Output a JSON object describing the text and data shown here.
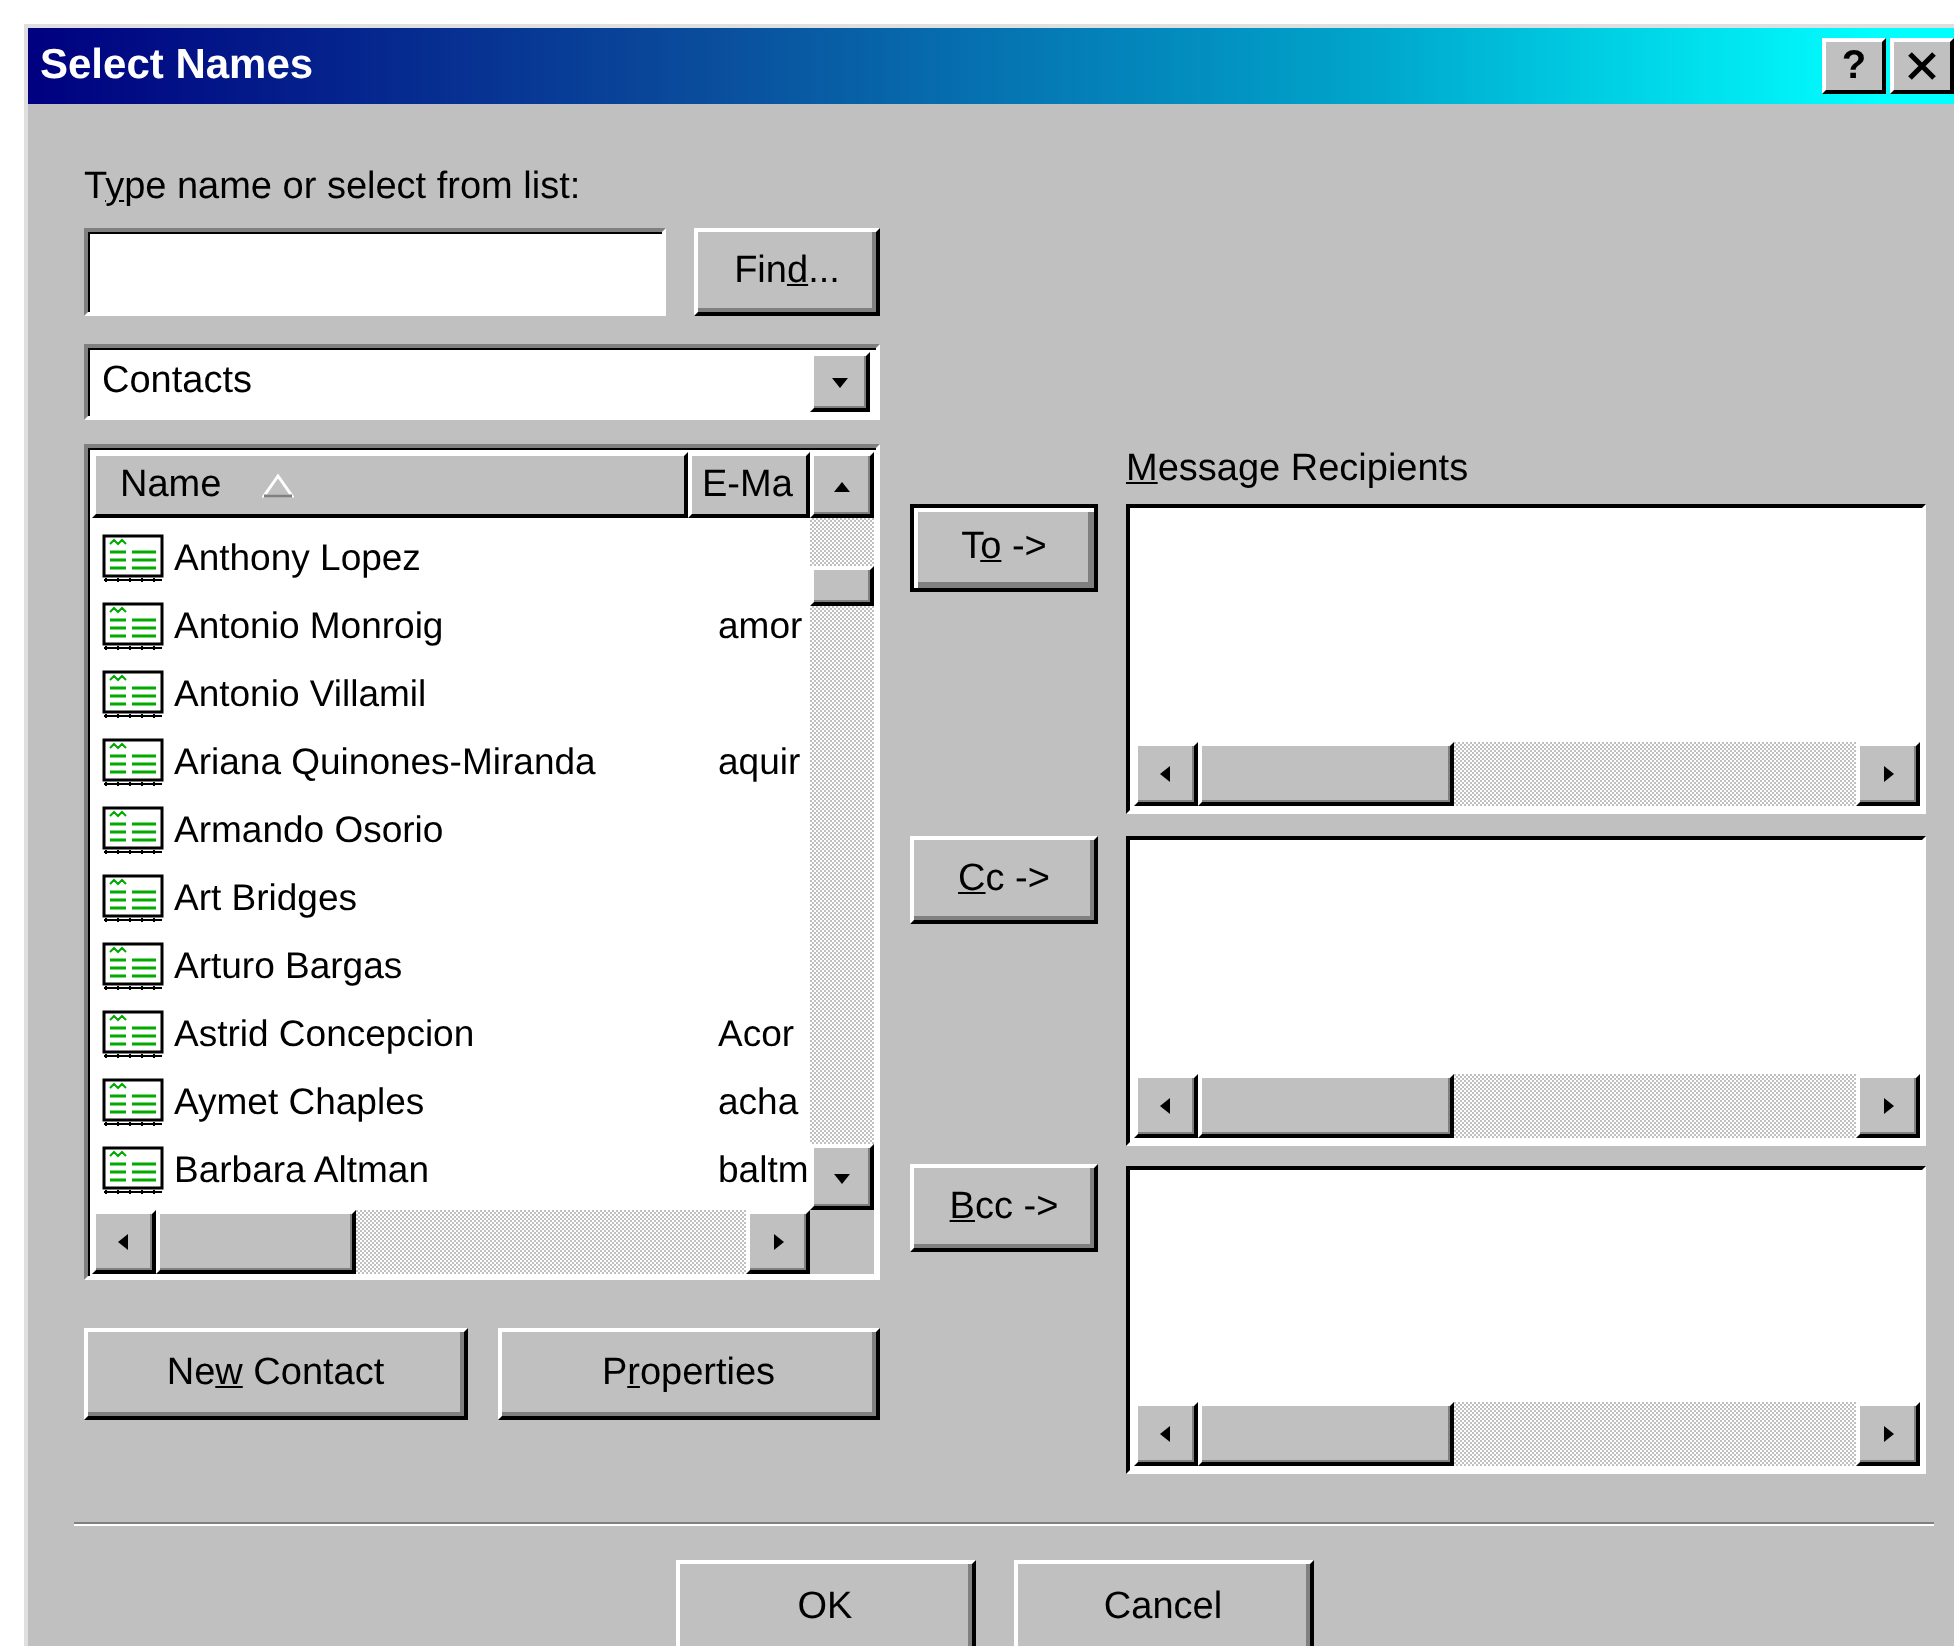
{
  "window": {
    "title": "Select Names",
    "help": "?"
  },
  "search": {
    "label": {
      "before": "T",
      "key": "y",
      "after": "pe name or select from list:"
    },
    "find_button": {
      "before": "Fin",
      "key": "d",
      "after": "..."
    }
  },
  "address_book": {
    "value": "Contacts"
  },
  "contacts": {
    "columns": [
      {
        "label": "Name",
        "sorted": true
      },
      {
        "label": "E-Ma",
        "sorted": false
      }
    ],
    "rows": [
      {
        "name": "Anthony Lopez"
      },
      {
        "name": "Antonio Monroig",
        "email": "amor"
      },
      {
        "name": "Antonio Villamil"
      },
      {
        "name": "Ariana Quinones-Miranda",
        "email": "aquir"
      },
      {
        "name": "Armando Osorio"
      },
      {
        "name": "Art Bridges"
      },
      {
        "name": "Arturo Bargas"
      },
      {
        "name": "Astrid Concepcion",
        "email": "Acor"
      },
      {
        "name": "Aymet Chaples",
        "email": "acha"
      },
      {
        "name": "Barbara Altman",
        "email": "baltm"
      }
    ]
  },
  "contact_buttons": [
    {
      "label": {
        "before": "Ne",
        "key": "w",
        "after": " Contact"
      }
    },
    {
      "label": {
        "before": "P",
        "key": "r",
        "after": "operties"
      }
    }
  ],
  "recipients": {
    "label": {
      "key": "M",
      "after": "essage Recipients"
    },
    "fields": [
      {
        "button": {
          "before": "T",
          "key": "o",
          "after": " ->"
        },
        "default": true
      },
      {
        "button": {
          "key": "C",
          "after": "c ->"
        },
        "default": false
      },
      {
        "button": {
          "key": "B",
          "after": "cc ->"
        },
        "default": false
      }
    ]
  },
  "dialog_buttons": [
    {
      "label": "OK"
    },
    {
      "label": "Cancel"
    }
  ]
}
